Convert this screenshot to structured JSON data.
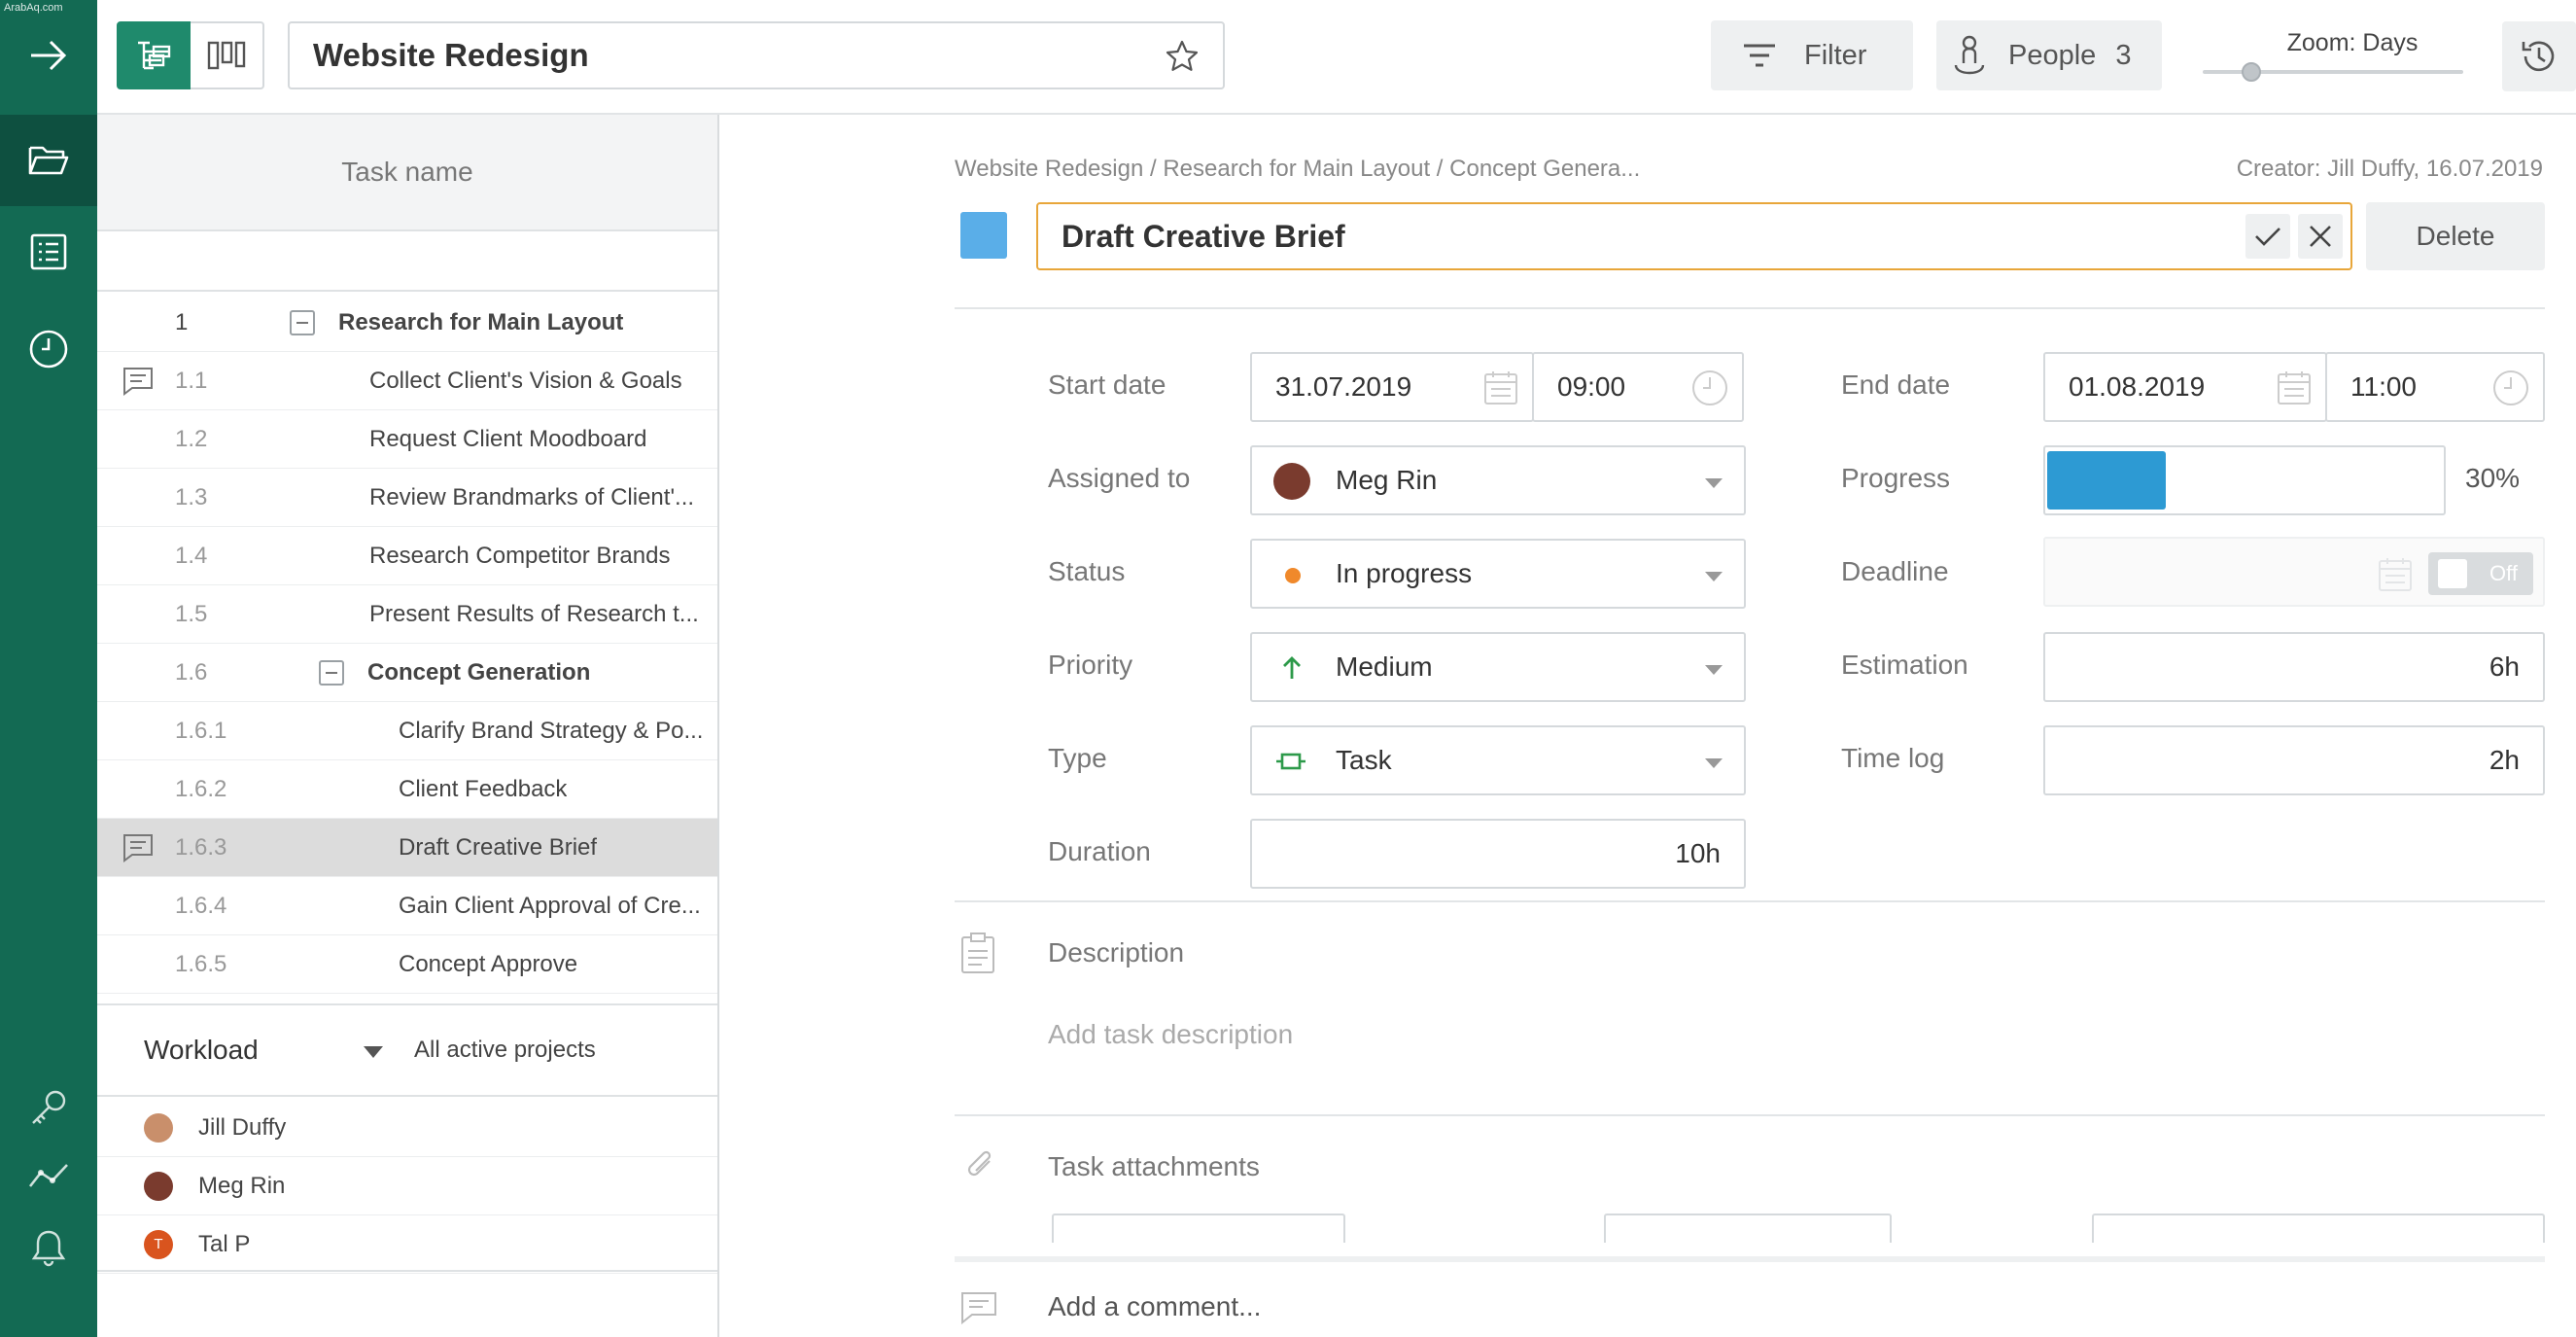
{
  "watermark": "ArabAq.com",
  "topbar": {
    "project_title": "Website Redesign",
    "filter_label": "Filter",
    "people_label": "People",
    "people_count": "3",
    "zoom_label": "Zoom: Days"
  },
  "tree": {
    "header": "Task name",
    "rows": [
      {
        "num": "1",
        "name": "Research for Main Layout"
      },
      {
        "num": "1.1",
        "name": "Collect Client's Vision & Goals"
      },
      {
        "num": "1.2",
        "name": "Request Client Moodboard"
      },
      {
        "num": "1.3",
        "name": "Review Brandmarks of Client'..."
      },
      {
        "num": "1.4",
        "name": "Research Competitor Brands"
      },
      {
        "num": "1.5",
        "name": "Present Results of Research t..."
      },
      {
        "num": "1.6",
        "name": "Concept Generation"
      },
      {
        "num": "1.6.1",
        "name": "Clarify Brand Strategy & Po..."
      },
      {
        "num": "1.6.2",
        "name": "Client Feedback"
      },
      {
        "num": "1.6.3",
        "name": "Draft Creative Brief"
      },
      {
        "num": "1.6.4",
        "name": "Gain Client Approval of Cre..."
      },
      {
        "num": "1.6.5",
        "name": "Concept Approve"
      }
    ]
  },
  "workload": {
    "title": "Workload",
    "filter": "All active projects",
    "people": [
      {
        "name": "Jill Duffy",
        "color": "#c98f6b"
      },
      {
        "name": "Meg Rin",
        "color": "#7a3b2e"
      },
      {
        "name": "Tal P",
        "initial": "T",
        "color": "#d9541e"
      }
    ]
  },
  "task": {
    "breadcrumb": "Website Redesign / Research for Main Layout / Concept Genera...",
    "creator": "Creator: Jill Duffy, 16.07.2019",
    "color": "#5aaee8",
    "title": "Draft Creative Brief",
    "delete_label": "Delete",
    "fields": {
      "start_date_label": "Start date",
      "start_date": "31.07.2019",
      "start_time": "09:00",
      "end_date_label": "End date",
      "end_date": "01.08.2019",
      "end_time": "11:00",
      "assigned_label": "Assigned to",
      "assigned": "Meg Rin",
      "progress_label": "Progress",
      "progress": 0.3,
      "progress_text": "30%",
      "status_label": "Status",
      "status": "In progress",
      "status_color": "#f0892b",
      "deadline_label": "Deadline",
      "deadline_toggle": "Off",
      "priority_label": "Priority",
      "priority": "Medium",
      "estimation_label": "Estimation",
      "estimation": "6h",
      "type_label": "Type",
      "type": "Task",
      "timelog_label": "Time log",
      "timelog": "2h",
      "duration_label": "Duration",
      "duration": "10h"
    },
    "description_title": "Description",
    "description_placeholder": "Add task description",
    "attachments_title": "Task attachments",
    "comment_placeholder": "Add a comment..."
  }
}
